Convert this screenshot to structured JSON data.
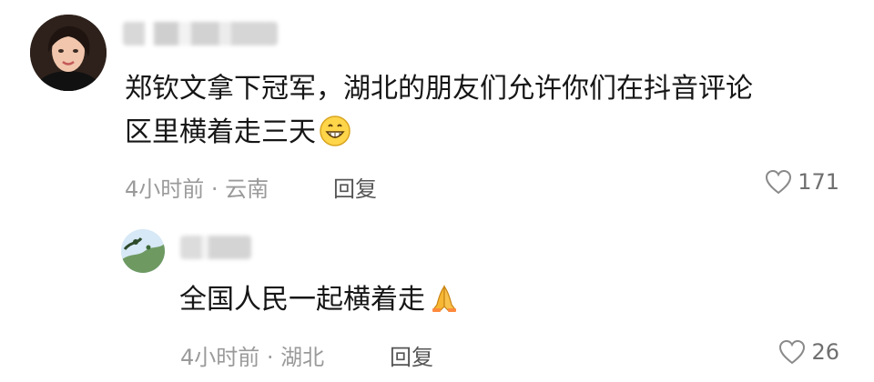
{
  "comments": [
    {
      "text_line1": "郑钦文拿下冠军，湖北的朋友们允许你们在抖音评论",
      "text_line2": "区里横着走三天",
      "emoji": "grinning-face",
      "meta": "4小时前 · 云南",
      "reply_label": "回复",
      "like_count": "171"
    },
    {
      "text": "全国人民一起横着走",
      "emoji": "folded-hands",
      "meta": "4小时前 · 湖北",
      "reply_label": "回复",
      "like_count": "26"
    }
  ],
  "colors": {
    "text": "#161616",
    "meta": "#9a9a9a",
    "reply": "#555555",
    "like": "#6f6f6f"
  }
}
